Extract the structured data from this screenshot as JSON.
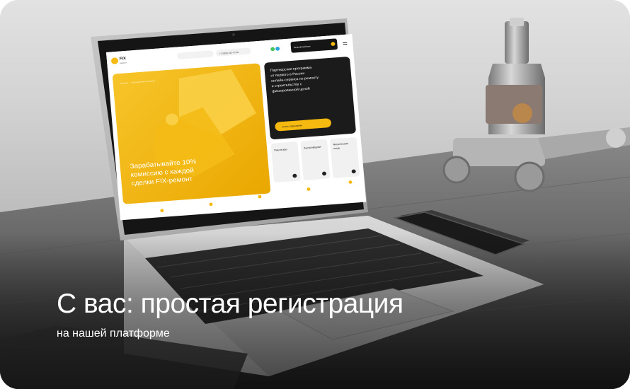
{
  "headline": "С вас: простая регистрация",
  "subline": "на нашей платформе",
  "screen": {
    "logo": "FIX",
    "logo_sub": "ремонт",
    "phone_1": "+7 (900) 222-77-00",
    "cabinet_button": "Личный кабинет",
    "breadcrumb": "Главная — Партнерская программа",
    "promo_text_line1": "Зарабатывайте 10%",
    "promo_text_line2": "комиссию с каждой",
    "promo_text_line3": "сделки FIX-ремонт",
    "dark_card_line1": "Партнерская программа",
    "dark_card_line2": "от первого в России",
    "dark_card_line3": "онлайн-сервиса по ремонту",
    "dark_card_line4": "и строительству с",
    "dark_card_line5": "фиксированной ценой",
    "dark_card_button": "Стать партнером",
    "tile_1": "Риелторы",
    "tile_2": "Застройщики",
    "tile_3_line1": "Физические",
    "tile_3_line2": "лица"
  },
  "colors": {
    "accent_yellow": "#f5b90f",
    "dark_card": "#1b1b1b",
    "headline_text": "#ffffff"
  }
}
